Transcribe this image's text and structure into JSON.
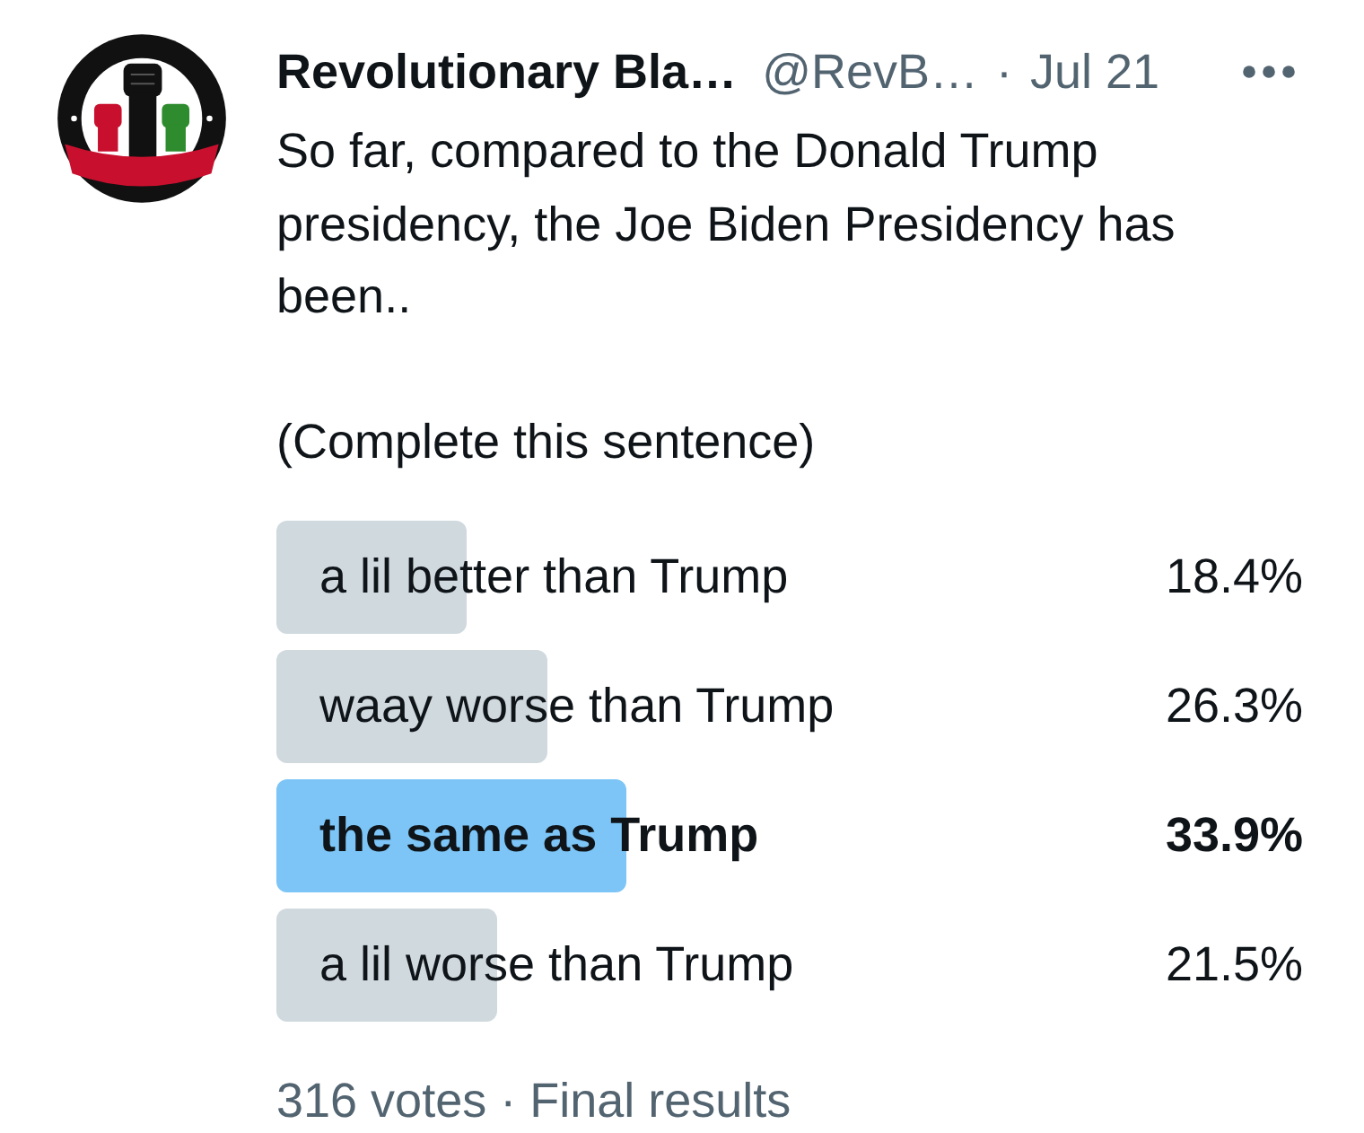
{
  "tweet": {
    "author": {
      "name": "Revolutionary Bla…",
      "handle": "@RevB…",
      "separator": "·",
      "date": "Jul 21"
    },
    "text": [
      "So far, compared to the Donald Trump presidency, the Joe Biden Presidency has been..",
      "(Complete this sentence)"
    ],
    "poll": {
      "options": [
        {
          "label": "a lil better than Trump",
          "percentage": "18.4%",
          "level": 0.184,
          "leading": false
        },
        {
          "label": "waay worse than Trump",
          "percentage": "26.3%",
          "level": 0.263,
          "leading": false
        },
        {
          "label": "the same as Trump",
          "percentage": "33.9%",
          "level": 0.339,
          "leading": true
        },
        {
          "label": "a lil worse than Trump",
          "percentage": "21.5%",
          "level": 0.215,
          "leading": false
        }
      ],
      "footer": "316 votes · Final results"
    }
  }
}
